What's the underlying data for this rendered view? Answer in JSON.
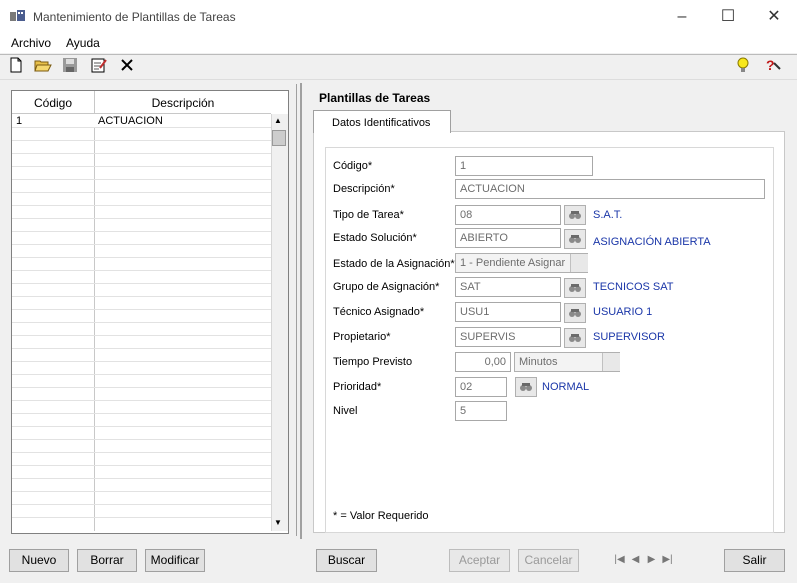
{
  "window": {
    "title": "Mantenimiento de Plantillas de Tareas"
  },
  "menu": {
    "file": "Archivo",
    "help": "Ayuda"
  },
  "toolbar": {
    "icons": [
      "new-document-icon",
      "open-folder-icon",
      "save-disk-icon",
      "edit-form-icon",
      "delete-x-icon",
      "tip-lightbulb-icon",
      "help-icon"
    ]
  },
  "grid": {
    "columns": [
      "Código",
      "Descripción"
    ],
    "rows": [
      {
        "codigo": "1",
        "descripcion": "ACTUACION"
      }
    ]
  },
  "panel": {
    "title": "Plantillas de Tareas",
    "tab": "Datos Identificativos",
    "required_note": "* = Valor Requerido"
  },
  "form": {
    "codigo": {
      "label": "Código*",
      "value": "1"
    },
    "descripcion": {
      "label": "Descripción*",
      "value": "ACTUACION"
    },
    "tipo_tarea": {
      "label": "Tipo de Tarea*",
      "value": "08",
      "desc": "S.A.T."
    },
    "estado_solucion": {
      "label": "Estado Solución*",
      "value": "ABIERTO",
      "desc": "ASIGNACIÓN ABIERTA"
    },
    "estado_asignacion": {
      "label": "Estado de la Asignación*",
      "value": "1 - Pendiente Asignar"
    },
    "grupo_asignacion": {
      "label": "Grupo de Asignación*",
      "value": "SAT",
      "desc": "TECNICOS SAT"
    },
    "tecnico_asignado": {
      "label": "Técnico Asignado*",
      "value": "USU1",
      "desc": "USUARIO 1"
    },
    "propietario": {
      "label": "Propietario*",
      "value": "SUPERVIS",
      "desc": "SUPERVISOR"
    },
    "tiempo_previsto": {
      "label": "Tiempo Previsto",
      "value": "0,00",
      "unit": "Minutos"
    },
    "prioridad": {
      "label": "Prioridad*",
      "value": "02",
      "desc": "NORMAL"
    },
    "nivel": {
      "label": "Nivel",
      "value": "5"
    }
  },
  "buttons": {
    "nuevo": "Nuevo",
    "borrar": "Borrar",
    "modificar": "Modificar",
    "buscar": "Buscar",
    "aceptar": "Aceptar",
    "cancelar": "Cancelar",
    "salir": "Salir"
  },
  "colors": {
    "desc_text": "#1a36a8",
    "accent_bar": "#2a6fd6"
  }
}
